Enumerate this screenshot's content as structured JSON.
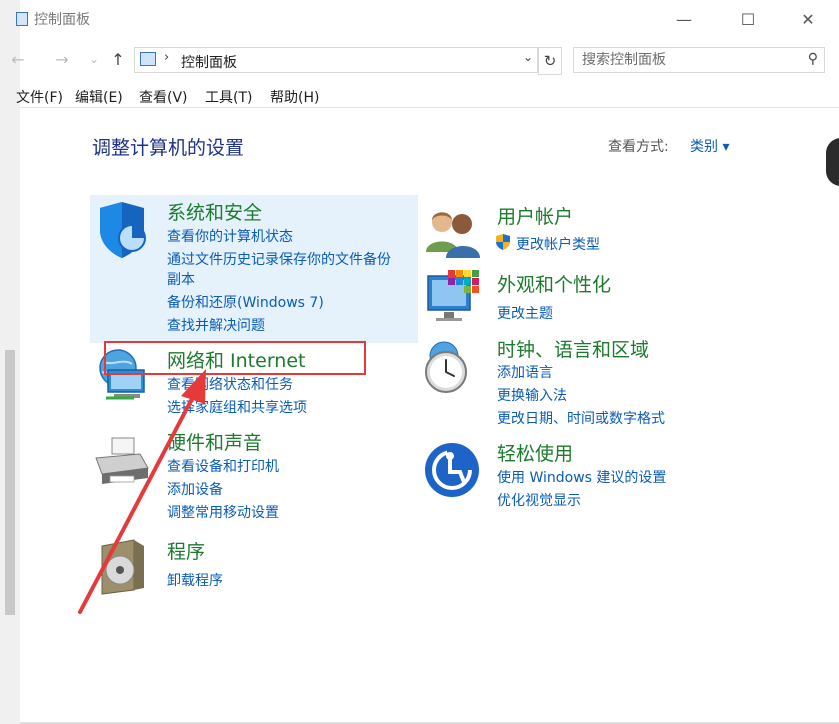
{
  "window": {
    "title": "控制面板",
    "controls": [
      "—",
      "☐",
      "✕"
    ]
  },
  "nav": {
    "back": "←",
    "forward": "→",
    "recent": "⌄",
    "up": "↑"
  },
  "address": {
    "separator": "›",
    "path": "控制面板",
    "dropdown": "⌄",
    "refresh": "↻"
  },
  "search": {
    "placeholder": "搜索控制面板",
    "icon": "⚲"
  },
  "menu": [
    "文件(F)",
    "编辑(E)",
    "查看(V)",
    "工具(T)",
    "帮助(H)"
  ],
  "main": {
    "heading": "调整计算机的设置",
    "view_by_label": "查看方式:",
    "view_by_value": "类别 ▾"
  },
  "categories_left": [
    {
      "title": "系统和安全",
      "icon": "shield-icon",
      "links": [
        "查看你的计算机状态",
        "通过文件历史记录保存你的文件备份",
        "副本",
        "备份和还原(Windows 7)",
        "查找并解决问题"
      ]
    },
    {
      "title": "网络和 Internet",
      "icon": "network-globe-icon",
      "links": [
        "查看网络状态和任务",
        "选择家庭组和共享选项"
      ]
    },
    {
      "title": "硬件和声音",
      "icon": "printer-icon",
      "links": [
        "查看设备和打印机",
        "添加设备",
        "调整常用移动设置"
      ]
    },
    {
      "title": "程序",
      "icon": "program-disc-icon",
      "links": [
        "卸载程序"
      ]
    }
  ],
  "categories_right": [
    {
      "title": "用户帐户",
      "icon": "users-icon",
      "links": [
        "更改帐户类型"
      ]
    },
    {
      "title": "外观和个性化",
      "icon": "monitor-palette-icon",
      "links": [
        "更改主题"
      ]
    },
    {
      "title": "时钟、语言和区域",
      "icon": "clock-icon",
      "links": [
        "添加语言",
        "更换输入法",
        "更改日期、时间或数字格式"
      ]
    },
    {
      "title": "轻松使用",
      "icon": "ease-of-access-icon",
      "links": [
        "使用 Windows 建议的设置",
        "优化视觉显示"
      ]
    }
  ],
  "colors": {
    "category_title": "#1d7a2f",
    "link": "#0a5cb8",
    "heading": "#1e3287",
    "highlight": "#e5f1fb",
    "annotation": "#e53a3a"
  }
}
